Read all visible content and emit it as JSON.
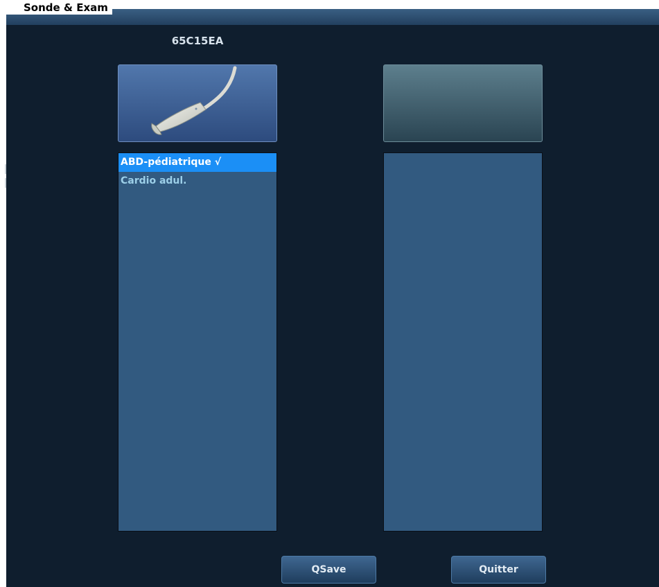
{
  "window": {
    "title": "Sonde & Exam"
  },
  "probe": {
    "name": "65C15EA",
    "icon": "ultrasound-probe-icon"
  },
  "exams": [
    {
      "label": "ABD-pédiatrique √",
      "selected": true
    },
    {
      "label": "Cardio adul.",
      "selected": false
    }
  ],
  "buttons": {
    "qsave_label": "QSave",
    "quit_label": "Quitter"
  },
  "colors": {
    "background": "#0f1e2e",
    "list_background": "#325a80",
    "selection": "#1b8ff6",
    "item_text": "#9ccfe8"
  }
}
